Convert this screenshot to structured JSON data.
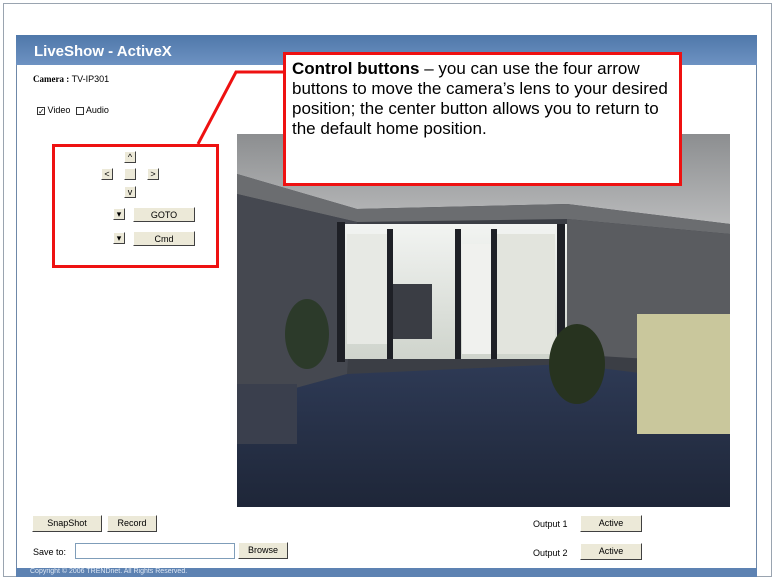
{
  "header": {
    "title": "LiveShow - ActiveX"
  },
  "camera": {
    "label": "Camera :",
    "value": "TV-IP301"
  },
  "options": {
    "video_label": "Video",
    "audio_label": "Audio",
    "video_checked": true,
    "audio_checked": false
  },
  "ptz": {
    "up": "^",
    "left": "<",
    "home": "",
    "right": ">",
    "down": "v",
    "goto_label": "GOTO",
    "cmd_label": "Cmd",
    "dropdown_glyph": "▾"
  },
  "callout": {
    "title": "Control buttons",
    "text": " – you can use the four arrow buttons to move the camera’s lens to your desired position; the center button allows you to return to the default home position."
  },
  "bottom": {
    "snapshot_label": "SnapShot",
    "record_label": "Record",
    "save_to_label": "Save to:",
    "save_to_value": "",
    "browse_label": "Browse",
    "output1_label": "Output 1",
    "output2_label": "Output 2",
    "active_label": "Active"
  },
  "footer": {
    "copyright": "Copyright © 2006 TRENDnet. All Rights Reserved."
  },
  "colors": {
    "header": "#5a82b4",
    "callout_border": "#e11111"
  }
}
